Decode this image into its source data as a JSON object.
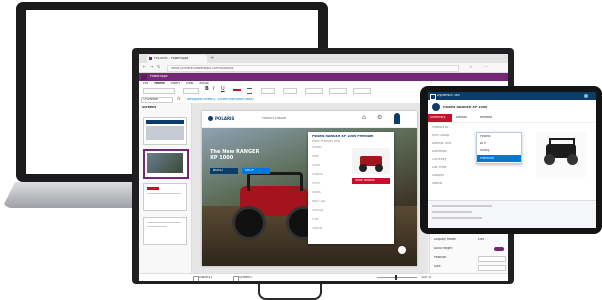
{
  "browser": {
    "tab_title": "POLARIS - PowerApps",
    "url": "https://create.powerapps.com/studio/#",
    "brand_initials": "PA",
    "brand_name": "PowerApps"
  },
  "studio": {
    "menu": [
      "File",
      "Home",
      "Insert",
      "View",
      "Action"
    ],
    "tree_header": "Screens",
    "formula_label": "OnVisible",
    "formula_value": "Navigate(Screen1, ScreenTransition.Fade)",
    "zoom": "100 %",
    "footer_left": "Gallery1",
    "footer_right": "Screen1"
  },
  "app": {
    "logo": "POLARIS",
    "page_title": "Product Details",
    "search_placeholder": "Search",
    "hero_text": "The New RANGER XP 1000",
    "card_title": "Polaris RANGER XP 1000 Premium",
    "card_subtitle": "Main Product Info",
    "card_button": "View Details",
    "hero_button_1": "BUILD",
    "hero_button_2": "SHOP",
    "field_labels": [
      "Model",
      "Year",
      "Color",
      "Engine",
      "Price",
      "Seats",
      "Bed Cap",
      "Towing",
      "Fuel",
      "Status"
    ]
  },
  "props": {
    "rows": [
      "Visible",
      "Display mode",
      "Auto height",
      "Position",
      "Size"
    ],
    "values": [
      "On",
      "Edit",
      "Off",
      "",
      ""
    ]
  },
  "tablet": {
    "app_name": "Dynamics 365",
    "record_title": "Polaris RANGER XP 1000",
    "tabs": [
      "Summary",
      "Details",
      "Related"
    ],
    "fields": [
      "Product ID",
      "Unit Group",
      "Default Unit",
      "Decimals",
      "Currency",
      "List Price",
      "Subject",
      "Status"
    ],
    "popup_items": [
      "Polaris",
      "ATV",
      "Utility",
      "Premium"
    ]
  },
  "colors": {
    "powerapps_purple": "#742774",
    "polaris_red": "#c8102e",
    "dynamics_blue": "#0b3d6b",
    "accent_blue": "#0078d4"
  }
}
